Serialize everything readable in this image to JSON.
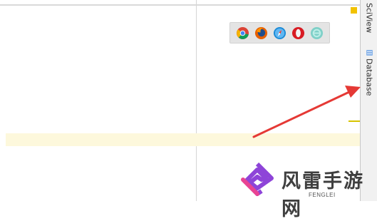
{
  "panel": {
    "tabs": [
      {
        "label": "SciView",
        "icon": "sciview-icon"
      },
      {
        "label": "Database",
        "icon": "database-icon"
      }
    ]
  },
  "browser_bar": {
    "icons": [
      "chrome-icon",
      "firefox-icon",
      "safari-icon",
      "opera-icon",
      "ie-icon"
    ]
  },
  "annotation": {
    "color": "#e53935"
  },
  "highlight_color": "#fdf8dc",
  "watermark": {
    "text": "风雷手游网",
    "subtitle": "FENGLEI"
  }
}
